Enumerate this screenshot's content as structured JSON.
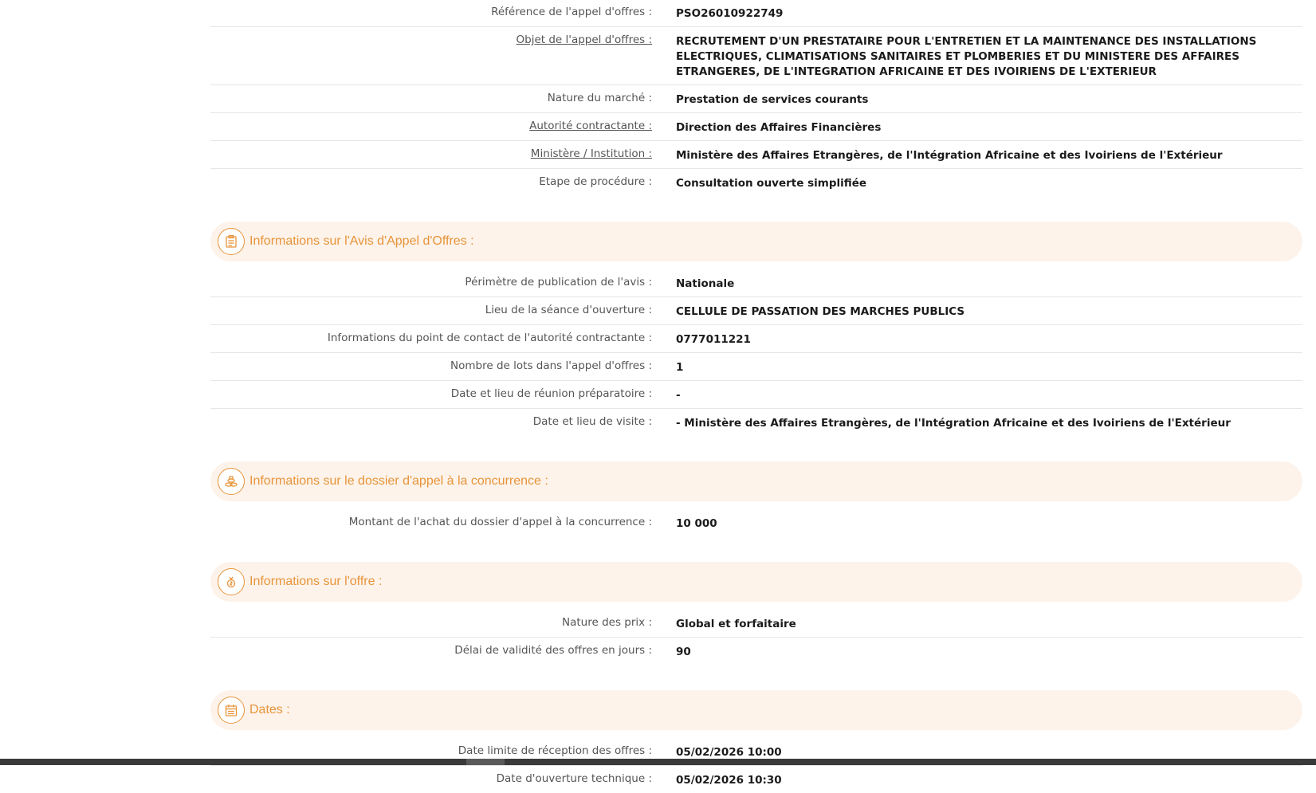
{
  "general": {
    "rows": [
      {
        "label": "Référence de l'appel d'offres :",
        "value": "PSO26010922749"
      },
      {
        "label": "Objet de l'appel d'offres :",
        "value": "RECRUTEMENT D'UN PRESTATAIRE POUR L'ENTRETIEN ET LA MAINTENANCE DES INSTALLATIONS ELECTRIQUES, CLIMATISATIONS SANITAIRES ET PLOMBERIES ET DU MINISTERE DES AFFAIRES ETRANGERES, DE L'INTEGRATION AFRICAINE ET DES IVOIRIENS DE L'EXTERIEUR"
      },
      {
        "label": "Nature du marché :",
        "value": "Prestation de services courants"
      },
      {
        "label": "Autorité contractante :",
        "value": "Direction des Affaires Financières"
      },
      {
        "label": "Ministère / Institution :",
        "value": "Ministère des Affaires Etrangères, de l'Intégration Africaine et des Ivoiriens de l'Extérieur"
      },
      {
        "label": "Etape de procédure :",
        "value": "Consultation ouverte simplifiée"
      }
    ]
  },
  "avis": {
    "title": "Informations sur l'Avis d'Appel d'Offres :",
    "icon": "clipboard-icon",
    "rows": [
      {
        "label": "Périmètre de publication de l'avis :",
        "value": "Nationale"
      },
      {
        "label": "Lieu de la séance d'ouverture :",
        "value": "CELLULE DE PASSATION DES MARCHES PUBLICS"
      },
      {
        "label": "Informations du point de contact de l'autorité contractante :",
        "value": "0777011221"
      },
      {
        "label": "Nombre de lots dans l'appel d'offres :",
        "value": "1"
      },
      {
        "label": "Date et lieu de réunion préparatoire :",
        "value": "-"
      },
      {
        "label": "Date et lieu de visite :",
        "value": "- Ministère des Affaires Etrangères, de l'Intégration Africaine et des Ivoiriens de l'Extérieur"
      }
    ]
  },
  "dossier": {
    "title": "Informations sur le dossier d'appel à la concurrence :",
    "icon": "coins-icon",
    "rows": [
      {
        "label": "Montant de l'achat du dossier d'appel à la concurrence :",
        "value": "10 000"
      }
    ]
  },
  "offre": {
    "title": "Informations sur l'offre :",
    "icon": "offer-icon",
    "rows": [
      {
        "label": "Nature des prix :",
        "value": "Global et forfaitaire"
      },
      {
        "label": "Délai de validité des offres en jours :",
        "value": "90"
      }
    ]
  },
  "dates": {
    "title": "Dates :",
    "icon": "calendar-icon",
    "rows": [
      {
        "label": "Date limite de réception des offres :",
        "value": "05/02/2026 10:00"
      },
      {
        "label": "Date d'ouverture technique :",
        "value": "05/02/2026 10:30"
      }
    ]
  },
  "colors": {
    "accent": "#e7943a",
    "section_bg": "#fdf3ea"
  }
}
